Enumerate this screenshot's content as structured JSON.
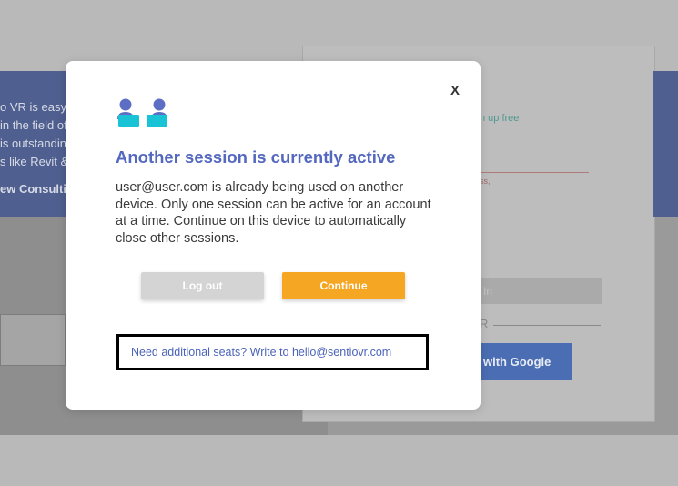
{
  "background": {
    "hero_text_lines": [
      "o VR is easy to",
      "in the field of",
      "is outstanding",
      "s like Revit &"
    ],
    "hero_link": "ew Consulting",
    "signup_text": "n up free",
    "error_text": "ss,",
    "login_button": "In",
    "divider_text": "R",
    "google_button": "with Google"
  },
  "modal": {
    "close_label": "X",
    "icon": "two-users-icon",
    "title": "Another session is currently active",
    "message": "user@user.com is already being used on another device. Only one session can be active for an account at a time. Continue on this device to automatically close other sessions.",
    "logout_label": "Log out",
    "continue_label": "Continue",
    "seats_text": "Need additional seats? Write to hello@sentiovr.com"
  },
  "colors": {
    "accent": "#5468c0",
    "continue": "#f5a623",
    "logout": "#d4d4d4",
    "icon_body": "#19c3d6",
    "icon_head": "#5c6fc4"
  }
}
